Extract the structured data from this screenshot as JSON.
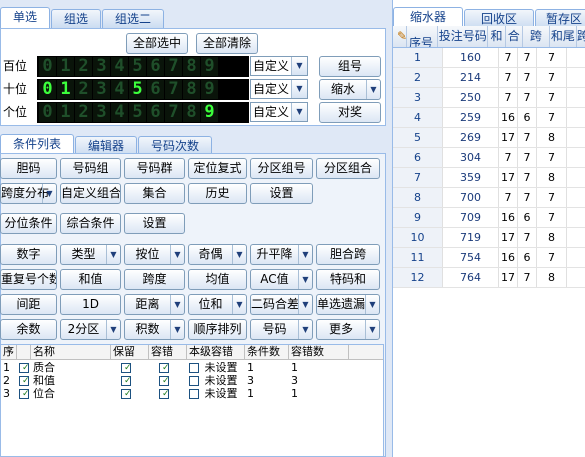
{
  "top_tabs": [
    "单选",
    "组选",
    "组选二"
  ],
  "select_all": "全部选中",
  "clear_all": "全部清除",
  "positions": [
    {
      "label": "百位",
      "select": "自定义",
      "side": "组号",
      "lit": [
        false,
        false,
        false,
        false,
        false,
        false,
        false,
        false,
        false,
        false
      ]
    },
    {
      "label": "十位",
      "select": "自定义",
      "side": "缩水",
      "lit": [
        true,
        true,
        false,
        false,
        false,
        true,
        false,
        false,
        false,
        false
      ]
    },
    {
      "label": "个位",
      "select": "自定义",
      "side": "对奖",
      "lit": [
        false,
        false,
        false,
        false,
        false,
        false,
        false,
        false,
        false,
        true
      ]
    }
  ],
  "digits": [
    "0",
    "1",
    "2",
    "3",
    "4",
    "5",
    "6",
    "7",
    "8",
    "9"
  ],
  "cond_tabs": [
    "条件列表",
    "编辑器",
    "号码次数"
  ],
  "cond_row1": [
    "胆码",
    "号码组",
    "号码群",
    "定位复式",
    "分区组号",
    "分区组合"
  ],
  "cond_row2": [
    "跨度分布",
    "自定义组合",
    "集合",
    "历史",
    "设置"
  ],
  "cond_row3": [
    "分位条件",
    "综合条件",
    "设置"
  ],
  "filter_rows": [
    [
      "数字",
      "类型",
      "按位",
      "奇偶",
      "升平降",
      "胆合跨"
    ],
    [
      "重复号个数",
      "和值",
      "跨度",
      "均值",
      "AC值",
      "特码和"
    ],
    [
      "间距",
      "1D",
      "距离",
      "位和",
      "二码合差",
      "单选遗漏"
    ],
    [
      "余数",
      "2分区",
      "积数",
      "顺序排列",
      "号码",
      "更多"
    ]
  ],
  "cond_grid": {
    "headers": [
      "序",
      "",
      "名称",
      "保留",
      "容错",
      "本级容错",
      "条件数",
      "容错数"
    ],
    "rows": [
      {
        "no": "1",
        "name": "质合",
        "tol": "未设置",
        "n": "1",
        "e": "1"
      },
      {
        "no": "2",
        "name": "和值",
        "tol": "未设置",
        "n": "3",
        "e": "3"
      },
      {
        "no": "3",
        "name": "位合",
        "tol": "未设置",
        "n": "1",
        "e": "1"
      }
    ]
  },
  "right_tabs": [
    "缩水器",
    "回收区",
    "暂存区"
  ],
  "result_headers": [
    "序号",
    "投注号码",
    "和",
    "合",
    "跨",
    "和尾",
    "跨"
  ],
  "results": [
    [
      "1",
      "160",
      "7",
      "7",
      "7"
    ],
    [
      "2",
      "214",
      "7",
      "7",
      "7"
    ],
    [
      "3",
      "250",
      "7",
      "7",
      "7"
    ],
    [
      "4",
      "259",
      "16",
      "6",
      "7"
    ],
    [
      "5",
      "269",
      "17",
      "7",
      "8"
    ],
    [
      "6",
      "304",
      "7",
      "7",
      "7"
    ],
    [
      "7",
      "359",
      "17",
      "7",
      "8"
    ],
    [
      "8",
      "700",
      "7",
      "7",
      "7"
    ],
    [
      "9",
      "709",
      "16",
      "6",
      "7"
    ],
    [
      "10",
      "719",
      "17",
      "7",
      "8"
    ],
    [
      "11",
      "754",
      "16",
      "6",
      "7"
    ],
    [
      "12",
      "764",
      "17",
      "7",
      "8"
    ]
  ]
}
